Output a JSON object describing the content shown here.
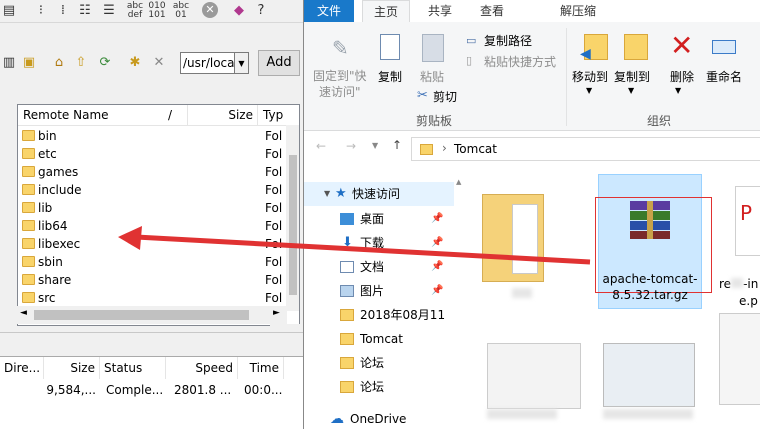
{
  "left": {
    "path": "/usr/local",
    "add_label": "Add",
    "columns": [
      "Remote Name",
      "/",
      "Size",
      "Typ"
    ],
    "files": [
      {
        "name": "bin",
        "type": "Fol"
      },
      {
        "name": "etc",
        "type": "Fol"
      },
      {
        "name": "games",
        "type": "Fol"
      },
      {
        "name": "include",
        "type": "Fol"
      },
      {
        "name": "lib",
        "type": "Fol"
      },
      {
        "name": "lib64",
        "type": "Fol"
      },
      {
        "name": "libexec",
        "type": "Fol"
      },
      {
        "name": "sbin",
        "type": "Fol"
      },
      {
        "name": "share",
        "type": "Fol"
      },
      {
        "name": "src",
        "type": "Fol"
      }
    ],
    "transfer_columns": [
      "Dire...",
      "Size",
      "Status",
      "Speed",
      "Time"
    ],
    "transfer_row": {
      "size": "9,584,...",
      "status": "Comple...",
      "speed": "2801.8 ...",
      "time": "00:0..."
    }
  },
  "right": {
    "tabs": {
      "file": "文件",
      "home": "主页",
      "share": "共享",
      "view": "查看",
      "extract": "解压缩"
    },
    "ribbon": {
      "pin": "固定到\"快\n速访问\"",
      "copy": "复制",
      "paste": "粘贴",
      "copy_path": "复制路径",
      "paste_shortcut": "粘贴快捷方式",
      "cut": "剪切",
      "clipboard_group": "剪贴板",
      "move_to": "移动到",
      "copy_to": "复制到",
      "delete": "删除",
      "rename": "重命名",
      "organize_group": "组织"
    },
    "address": "Tomcat",
    "nav": {
      "quick_access": "快速访问",
      "desktop": "桌面",
      "downloads": "下载",
      "documents": "文档",
      "pictures": "图片",
      "folder_date": "2018年08月11",
      "tomcat": "Tomcat",
      "forum1": "论坛",
      "forum2": "论坛",
      "onedrive": "OneDrive"
    },
    "files": {
      "selected": "apache-tomcat-8.5.32.tar.gz",
      "selected_l1": "apache-tomcat-",
      "selected_l2": "8.5.32.tar.gz",
      "partial_l1": "re",
      "partial_l1b": "-in",
      "partial_l2": "e.p"
    }
  },
  "colors": {
    "accent": "#1979ca",
    "arrow": "#e03232",
    "selection": "#cce8ff",
    "highlight_box": "#e03232"
  }
}
